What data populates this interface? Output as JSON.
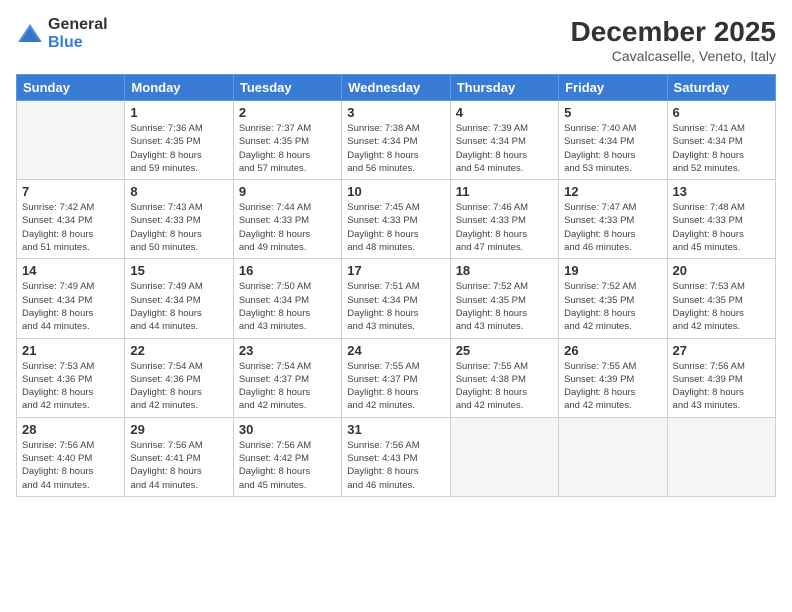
{
  "logo": {
    "general": "General",
    "blue": "Blue"
  },
  "title": "December 2025",
  "location": "Cavalcaselle, Veneto, Italy",
  "days_header": [
    "Sunday",
    "Monday",
    "Tuesday",
    "Wednesday",
    "Thursday",
    "Friday",
    "Saturday"
  ],
  "weeks": [
    [
      {
        "day": "",
        "info": ""
      },
      {
        "day": "1",
        "info": "Sunrise: 7:36 AM\nSunset: 4:35 PM\nDaylight: 8 hours\nand 59 minutes."
      },
      {
        "day": "2",
        "info": "Sunrise: 7:37 AM\nSunset: 4:35 PM\nDaylight: 8 hours\nand 57 minutes."
      },
      {
        "day": "3",
        "info": "Sunrise: 7:38 AM\nSunset: 4:34 PM\nDaylight: 8 hours\nand 56 minutes."
      },
      {
        "day": "4",
        "info": "Sunrise: 7:39 AM\nSunset: 4:34 PM\nDaylight: 8 hours\nand 54 minutes."
      },
      {
        "day": "5",
        "info": "Sunrise: 7:40 AM\nSunset: 4:34 PM\nDaylight: 8 hours\nand 53 minutes."
      },
      {
        "day": "6",
        "info": "Sunrise: 7:41 AM\nSunset: 4:34 PM\nDaylight: 8 hours\nand 52 minutes."
      }
    ],
    [
      {
        "day": "7",
        "info": "Sunrise: 7:42 AM\nSunset: 4:34 PM\nDaylight: 8 hours\nand 51 minutes."
      },
      {
        "day": "8",
        "info": "Sunrise: 7:43 AM\nSunset: 4:33 PM\nDaylight: 8 hours\nand 50 minutes."
      },
      {
        "day": "9",
        "info": "Sunrise: 7:44 AM\nSunset: 4:33 PM\nDaylight: 8 hours\nand 49 minutes."
      },
      {
        "day": "10",
        "info": "Sunrise: 7:45 AM\nSunset: 4:33 PM\nDaylight: 8 hours\nand 48 minutes."
      },
      {
        "day": "11",
        "info": "Sunrise: 7:46 AM\nSunset: 4:33 PM\nDaylight: 8 hours\nand 47 minutes."
      },
      {
        "day": "12",
        "info": "Sunrise: 7:47 AM\nSunset: 4:33 PM\nDaylight: 8 hours\nand 46 minutes."
      },
      {
        "day": "13",
        "info": "Sunrise: 7:48 AM\nSunset: 4:33 PM\nDaylight: 8 hours\nand 45 minutes."
      }
    ],
    [
      {
        "day": "14",
        "info": "Sunrise: 7:49 AM\nSunset: 4:34 PM\nDaylight: 8 hours\nand 44 minutes."
      },
      {
        "day": "15",
        "info": "Sunrise: 7:49 AM\nSunset: 4:34 PM\nDaylight: 8 hours\nand 44 minutes."
      },
      {
        "day": "16",
        "info": "Sunrise: 7:50 AM\nSunset: 4:34 PM\nDaylight: 8 hours\nand 43 minutes."
      },
      {
        "day": "17",
        "info": "Sunrise: 7:51 AM\nSunset: 4:34 PM\nDaylight: 8 hours\nand 43 minutes."
      },
      {
        "day": "18",
        "info": "Sunrise: 7:52 AM\nSunset: 4:35 PM\nDaylight: 8 hours\nand 43 minutes."
      },
      {
        "day": "19",
        "info": "Sunrise: 7:52 AM\nSunset: 4:35 PM\nDaylight: 8 hours\nand 42 minutes."
      },
      {
        "day": "20",
        "info": "Sunrise: 7:53 AM\nSunset: 4:35 PM\nDaylight: 8 hours\nand 42 minutes."
      }
    ],
    [
      {
        "day": "21",
        "info": "Sunrise: 7:53 AM\nSunset: 4:36 PM\nDaylight: 8 hours\nand 42 minutes."
      },
      {
        "day": "22",
        "info": "Sunrise: 7:54 AM\nSunset: 4:36 PM\nDaylight: 8 hours\nand 42 minutes."
      },
      {
        "day": "23",
        "info": "Sunrise: 7:54 AM\nSunset: 4:37 PM\nDaylight: 8 hours\nand 42 minutes."
      },
      {
        "day": "24",
        "info": "Sunrise: 7:55 AM\nSunset: 4:37 PM\nDaylight: 8 hours\nand 42 minutes."
      },
      {
        "day": "25",
        "info": "Sunrise: 7:55 AM\nSunset: 4:38 PM\nDaylight: 8 hours\nand 42 minutes."
      },
      {
        "day": "26",
        "info": "Sunrise: 7:55 AM\nSunset: 4:39 PM\nDaylight: 8 hours\nand 42 minutes."
      },
      {
        "day": "27",
        "info": "Sunrise: 7:56 AM\nSunset: 4:39 PM\nDaylight: 8 hours\nand 43 minutes."
      }
    ],
    [
      {
        "day": "28",
        "info": "Sunrise: 7:56 AM\nSunset: 4:40 PM\nDaylight: 8 hours\nand 44 minutes."
      },
      {
        "day": "29",
        "info": "Sunrise: 7:56 AM\nSunset: 4:41 PM\nDaylight: 8 hours\nand 44 minutes."
      },
      {
        "day": "30",
        "info": "Sunrise: 7:56 AM\nSunset: 4:42 PM\nDaylight: 8 hours\nand 45 minutes."
      },
      {
        "day": "31",
        "info": "Sunrise: 7:56 AM\nSunset: 4:43 PM\nDaylight: 8 hours\nand 46 minutes."
      },
      {
        "day": "",
        "info": ""
      },
      {
        "day": "",
        "info": ""
      },
      {
        "day": "",
        "info": ""
      }
    ]
  ]
}
